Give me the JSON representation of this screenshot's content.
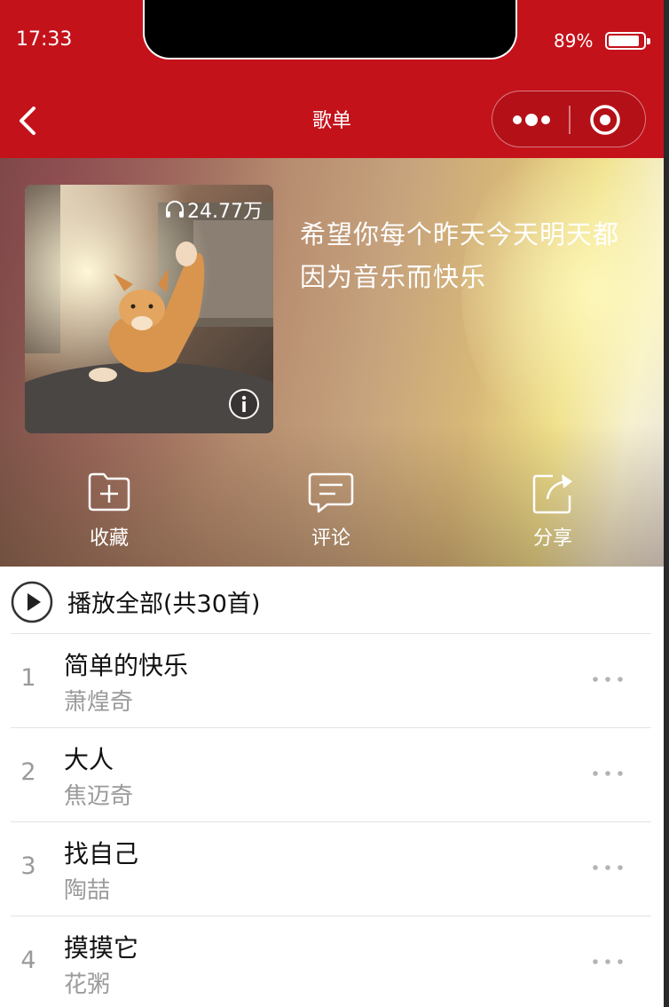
{
  "status_bar": {
    "time": "17:33",
    "battery": "89%"
  },
  "nav": {
    "title": "歌单"
  },
  "playlist": {
    "play_count": "24.77万",
    "description": "希望你每个昨天今天明天都因为音乐而快乐"
  },
  "actions": [
    {
      "label": "收藏",
      "icon": "folder-plus-icon"
    },
    {
      "label": "评论",
      "icon": "comment-icon"
    },
    {
      "label": "分享",
      "icon": "share-icon"
    }
  ],
  "play_all": {
    "label": "播放全部(共30首)"
  },
  "songs": [
    {
      "index": "1",
      "title": "简单的快乐",
      "artist": "萧煌奇"
    },
    {
      "index": "2",
      "title": "大人",
      "artist": "焦迈奇"
    },
    {
      "index": "3",
      "title": "找自己",
      "artist": "陶喆"
    },
    {
      "index": "4",
      "title": "摸摸它",
      "artist": "花粥"
    }
  ],
  "colors": {
    "header_red": "#c4121b",
    "text_gray": "#9a9a9a"
  }
}
